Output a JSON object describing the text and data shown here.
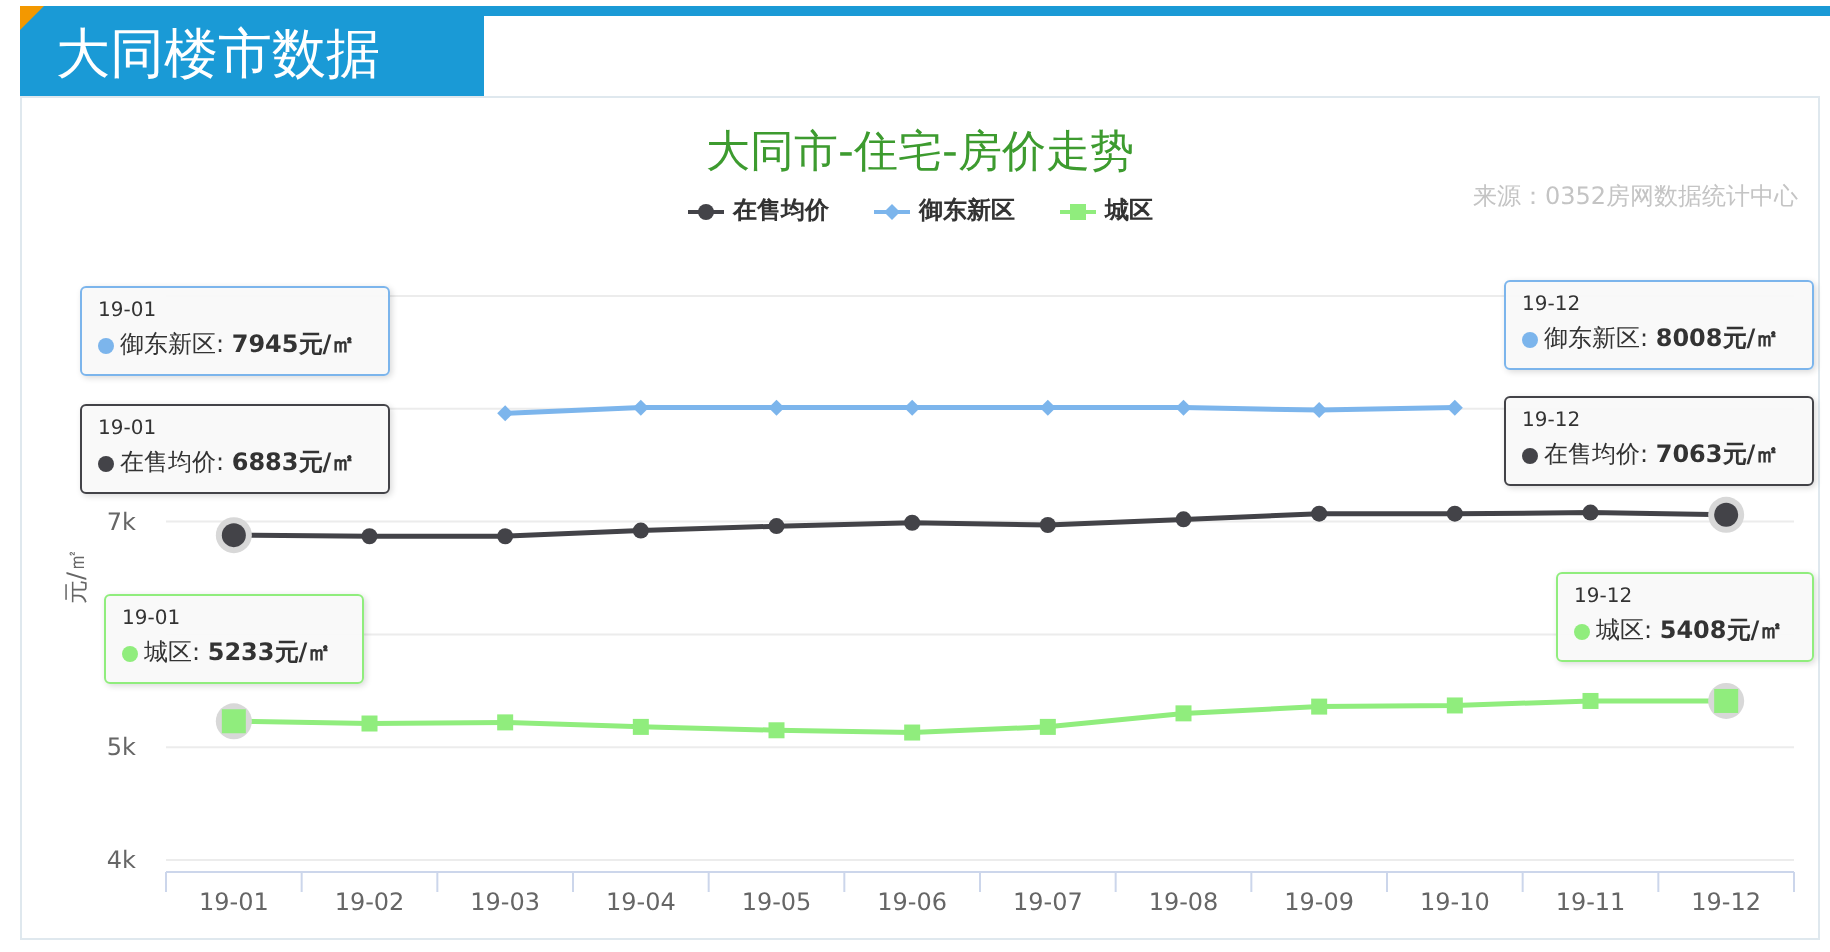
{
  "header": {
    "title": "大同楼市数据"
  },
  "chart": {
    "source": "来源：0352房网数据统计中心",
    "chart_data": {
      "type": "line",
      "title": "大同市-住宅-房价走势",
      "ylabel": "元/㎡",
      "categories": [
        "19-01",
        "19-02",
        "19-03",
        "19-04",
        "19-05",
        "19-06",
        "19-07",
        "19-08",
        "19-09",
        "19-10",
        "19-11",
        "19-12"
      ],
      "series": [
        {
          "name": "在售均价",
          "color": "#434348",
          "marker": "circle",
          "values": [
            6880,
            6870,
            6870,
            6920,
            6960,
            6990,
            6970,
            7020,
            7070,
            7070,
            7080,
            7060
          ]
        },
        {
          "name": "御东新区",
          "color": "#7cb5ec",
          "marker": "diamond",
          "values": [
            null,
            null,
            7960,
            8010,
            8010,
            8010,
            8010,
            8010,
            7990,
            8010,
            null,
            null
          ]
        },
        {
          "name": "城区",
          "color": "#90ed7d",
          "marker": "square",
          "values": [
            5230,
            5210,
            5220,
            5180,
            5150,
            5130,
            5180,
            5300,
            5360,
            5370,
            5410,
            5410
          ]
        }
      ],
      "ylim": [
        4000,
        9000
      ],
      "yticks": [
        {
          "value": 4000,
          "label": "4k"
        },
        {
          "value": 5000,
          "label": "5k"
        },
        {
          "value": 7000,
          "label": "7k"
        }
      ]
    },
    "tooltips": [
      {
        "label": "19-01",
        "text": "御东新区: **7945元/㎡**",
        "color": "#7cb5ec"
      },
      {
        "label": "19-01",
        "text": "在售均价: **6883元/㎡**",
        "color": "#434348"
      },
      {
        "label": "19-01",
        "text": "城区: **5233元/㎡**",
        "color": "#90ed7d"
      },
      {
        "label": "19-12",
        "text": "御东新区: **8008元/㎡**",
        "color": "#7cb5ec"
      },
      {
        "label": "19-12",
        "text": "在售均价: **7063元/㎡**",
        "color": "#434348"
      },
      {
        "label": "19-12",
        "text": "城区: **5408元/㎡**",
        "color": "#90ed7d"
      }
    ]
  }
}
